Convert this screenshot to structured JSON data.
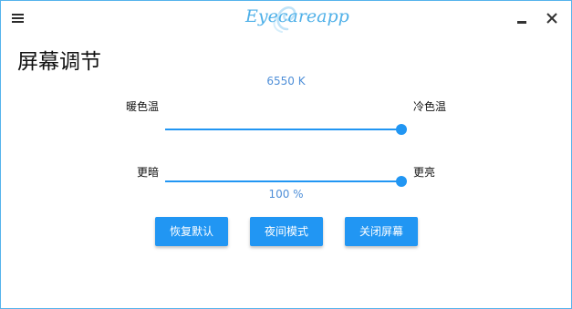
{
  "app": {
    "logo_text": "Eyecareapp",
    "accent_color": "#2196f3",
    "border_color": "#55b3ec"
  },
  "titlebar": {
    "menu_icon": "hamburger-menu-icon",
    "minimize_icon": "minimize-icon",
    "close_icon": "close-icon"
  },
  "page": {
    "title": "屏幕调节"
  },
  "temperature": {
    "value_text": "6550 K",
    "left_label": "暖色温",
    "right_label": "冷色温",
    "level_fraction": 1.0
  },
  "brightness": {
    "value_text": "100 %",
    "left_label": "更暗",
    "right_label": "更亮",
    "level_fraction": 1.0
  },
  "buttons": {
    "restore_default": "恢复默认",
    "night_mode": "夜间模式",
    "turn_off_screen": "关闭屏幕"
  }
}
